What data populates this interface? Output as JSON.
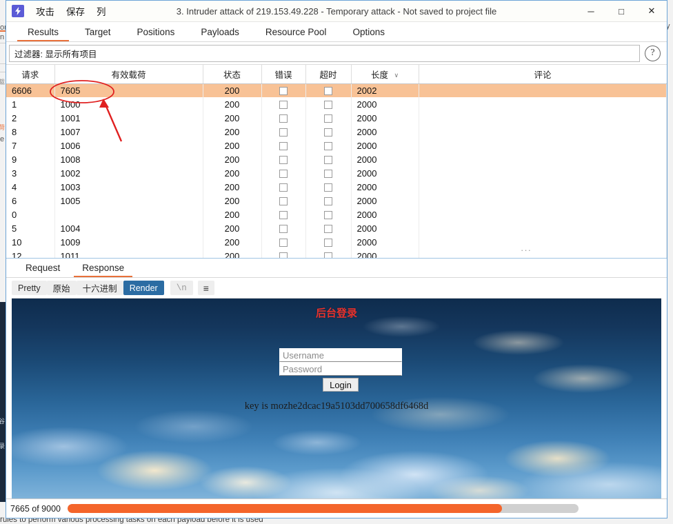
{
  "window": {
    "title": "3. Intruder attack of 219.153.49.228 - Temporary attack - Not saved to project file",
    "app_icon": "lightning-bolt-icon",
    "menu": [
      "攻击",
      "保存",
      "列"
    ],
    "controls": {
      "minimize": "─",
      "maximize": "□",
      "close": "✕"
    }
  },
  "tabs": [
    {
      "label": "Results",
      "active": true
    },
    {
      "label": "Target",
      "active": false
    },
    {
      "label": "Positions",
      "active": false
    },
    {
      "label": "Payloads",
      "active": false
    },
    {
      "label": "Resource Pool",
      "active": false
    },
    {
      "label": "Options",
      "active": false
    }
  ],
  "filter": {
    "value": "过滤器: 显示所有项目",
    "help_glyph": "?"
  },
  "results_table": {
    "columns": [
      "请求",
      "有效载荷",
      "状态",
      "错误",
      "超时",
      "长度",
      "评论"
    ],
    "sorted_column": "长度",
    "sort_caret": "∨",
    "ellipsis": "···",
    "rows": [
      {
        "request": "6606",
        "payload": "7605",
        "status": "200",
        "error": false,
        "timeout": false,
        "length": "2002",
        "comment": "",
        "selected": true
      },
      {
        "request": "1",
        "payload": "1000",
        "status": "200",
        "error": false,
        "timeout": false,
        "length": "2000",
        "comment": "",
        "selected": false
      },
      {
        "request": "2",
        "payload": "1001",
        "status": "200",
        "error": false,
        "timeout": false,
        "length": "2000",
        "comment": "",
        "selected": false
      },
      {
        "request": "8",
        "payload": "1007",
        "status": "200",
        "error": false,
        "timeout": false,
        "length": "2000",
        "comment": "",
        "selected": false
      },
      {
        "request": "7",
        "payload": "1006",
        "status": "200",
        "error": false,
        "timeout": false,
        "length": "2000",
        "comment": "",
        "selected": false
      },
      {
        "request": "9",
        "payload": "1008",
        "status": "200",
        "error": false,
        "timeout": false,
        "length": "2000",
        "comment": "",
        "selected": false
      },
      {
        "request": "3",
        "payload": "1002",
        "status": "200",
        "error": false,
        "timeout": false,
        "length": "2000",
        "comment": "",
        "selected": false
      },
      {
        "request": "4",
        "payload": "1003",
        "status": "200",
        "error": false,
        "timeout": false,
        "length": "2000",
        "comment": "",
        "selected": false
      },
      {
        "request": "6",
        "payload": "1005",
        "status": "200",
        "error": false,
        "timeout": false,
        "length": "2000",
        "comment": "",
        "selected": false
      },
      {
        "request": "0",
        "payload": "",
        "status": "200",
        "error": false,
        "timeout": false,
        "length": "2000",
        "comment": "",
        "selected": false
      },
      {
        "request": "5",
        "payload": "1004",
        "status": "200",
        "error": false,
        "timeout": false,
        "length": "2000",
        "comment": "",
        "selected": false
      },
      {
        "request": "10",
        "payload": "1009",
        "status": "200",
        "error": false,
        "timeout": false,
        "length": "2000",
        "comment": "",
        "selected": false
      },
      {
        "request": "12",
        "payload": "1011",
        "status": "200",
        "error": false,
        "timeout": false,
        "length": "2000",
        "comment": "",
        "selected": false
      }
    ]
  },
  "message_tabs": [
    {
      "label": "Request",
      "active": false
    },
    {
      "label": "Response",
      "active": true
    }
  ],
  "render_toolbar": {
    "views": [
      {
        "label": "Pretty",
        "active": false
      },
      {
        "label": "原始",
        "active": false
      },
      {
        "label": "十六进制",
        "active": false
      },
      {
        "label": "Render",
        "active": true
      }
    ],
    "newline_label": "\\n",
    "menu_glyph": "≡"
  },
  "rendered_page": {
    "heading": "后台登录",
    "username_placeholder": "Username",
    "password_placeholder": "Password",
    "login_button": "Login",
    "key_line": "key is mozhe2dcac19a5103dd700658df6468d"
  },
  "status": {
    "count_text": "7665 of 9000",
    "progress_percent": 85,
    "progress_color": "#f4652b"
  },
  "background_window": {
    "left_fragments": [
      "on",
      "n",
      "载",
      "荷",
      "e"
    ],
    "right_fragment": "y",
    "bottom_text": "rules to perform various processing tasks on each payload before it is used"
  },
  "annotation": {
    "ellipse_target": "7605",
    "color": "#e02020"
  }
}
